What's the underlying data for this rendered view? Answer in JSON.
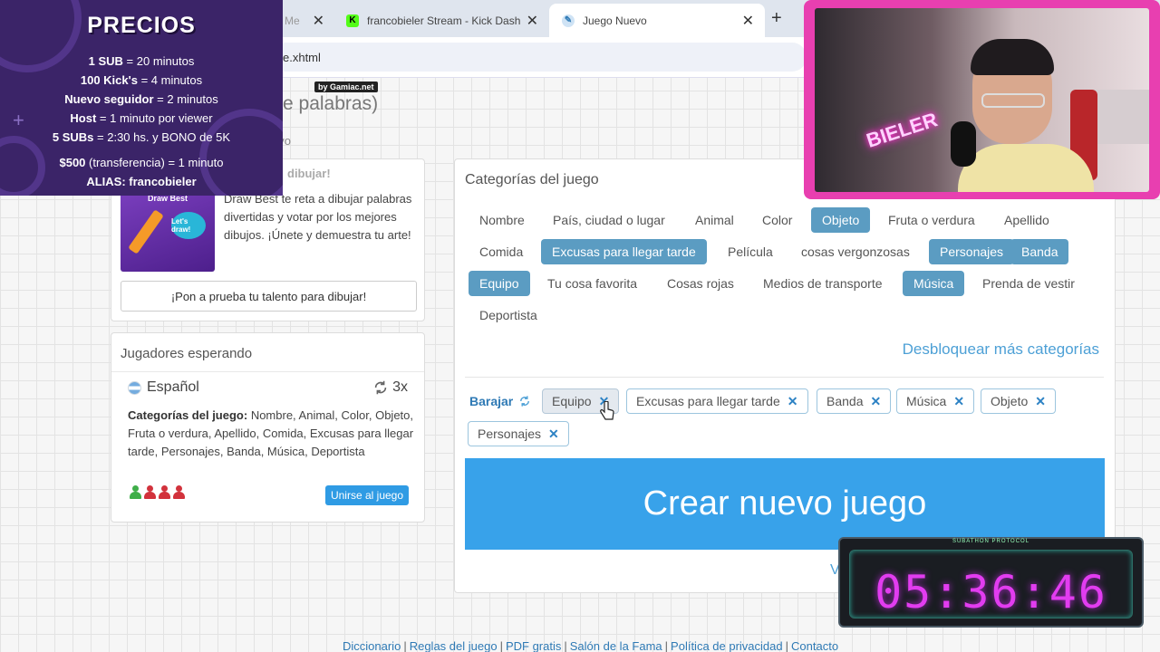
{
  "browser": {
    "tabs": [
      {
        "title": "Me",
        "active": false
      },
      {
        "title": "francobieler Stream - Kick Dash",
        "active": false
      },
      {
        "title": "Juego Nuevo",
        "active": true
      }
    ],
    "url_fragment": "e.xhtml"
  },
  "page": {
    "title_fragment": "e palabras)",
    "crumb_fragment": "evo"
  },
  "draw_promo": {
    "heading_fragment": "dibujar!",
    "image_caption": "Draw Best",
    "image_bubble": "Let's draw!",
    "text": "Draw Best te reta a dibujar palabras divertidas y votar por los mejores dibujos. ¡Únete y demuestra tu arte!",
    "button": "¡Pon a prueba tu talento para dibujar!"
  },
  "waiting": {
    "heading": "Jugadores esperando",
    "language": "Español",
    "rounds": "3x",
    "categories_label": "Categorías del juego:",
    "categories_value": " Nombre, Animal, Color, Objeto, Fruta o verdura, Apellido, Comida, Excusas para llegar tarde, Personajes, Banda, Música, Deportista",
    "avatar_colors": [
      "#3fae49",
      "#d2323c",
      "#d2323c",
      "#d2323c"
    ],
    "join_button": "Unirse al juego"
  },
  "game": {
    "heading": "Categorías del juego",
    "categories": [
      {
        "label": "Nombre",
        "selected": false
      },
      {
        "label": "País, ciudad o lugar",
        "selected": false
      },
      {
        "label": "Animal",
        "selected": false
      },
      {
        "label": "Color",
        "selected": false
      },
      {
        "label": "Objeto",
        "selected": true
      },
      {
        "label": "Fruta o verdura",
        "selected": false
      },
      {
        "label": "Apellido",
        "selected": false
      },
      {
        "label": "Comida",
        "selected": false
      },
      {
        "label": "Excusas para llegar tarde",
        "selected": true
      },
      {
        "label": "Película",
        "selected": false
      },
      {
        "label": "cosas vergonzosas",
        "selected": false
      },
      {
        "label": "Personajes",
        "selected": true
      },
      {
        "label": "Banda",
        "selected": true
      },
      {
        "label": "Equipo",
        "selected": true
      },
      {
        "label": "Tu cosa favorita",
        "selected": false
      },
      {
        "label": "Cosas rojas",
        "selected": false
      },
      {
        "label": "Medios de transporte",
        "selected": false
      },
      {
        "label": "Música",
        "selected": true
      },
      {
        "label": "Prenda de vestir",
        "selected": false
      },
      {
        "label": "Deportista",
        "selected": false
      }
    ],
    "unlock_more": "Desbloquear más categorías",
    "shuffle_label": "Barajar",
    "chosen": [
      "Equipo",
      "Excusas para llegar tarde",
      "Banda",
      "Música",
      "Objeto",
      "Personajes"
    ],
    "create_button": "Crear nuevo juego",
    "more_link_fragment": "V"
  },
  "footer": {
    "links": [
      "Diccionario",
      "Reglas del juego",
      "PDF gratis",
      "Salón de la Fama",
      "Política de privacidad",
      "Contacto"
    ]
  },
  "overlay": {
    "prices_title": "PRECIOS",
    "price_lines": [
      {
        "key": "1 SUB",
        "value": " = 20 minutos"
      },
      {
        "key": "100 Kick's",
        "value": " = 4 minutos"
      },
      {
        "key": "Nuevo seguidor",
        "value": " = 2 minutos"
      },
      {
        "key": "Host",
        "value": " = 1 minuto por viewer"
      },
      {
        "key": "5 SUBs",
        "value": " = 2:30 hs. y BONO de 5K"
      },
      {
        "key": "$500",
        "value": " (transferencia) = 1 minuto"
      },
      {
        "key": "ALIAS: francobieler",
        "value": ""
      }
    ],
    "gamiac_badge": "by Gamiac.net",
    "webcam_neon": "BIELER",
    "timer_label": "SUBATHON PROTOCOL",
    "timer_value": "05:36:46"
  }
}
